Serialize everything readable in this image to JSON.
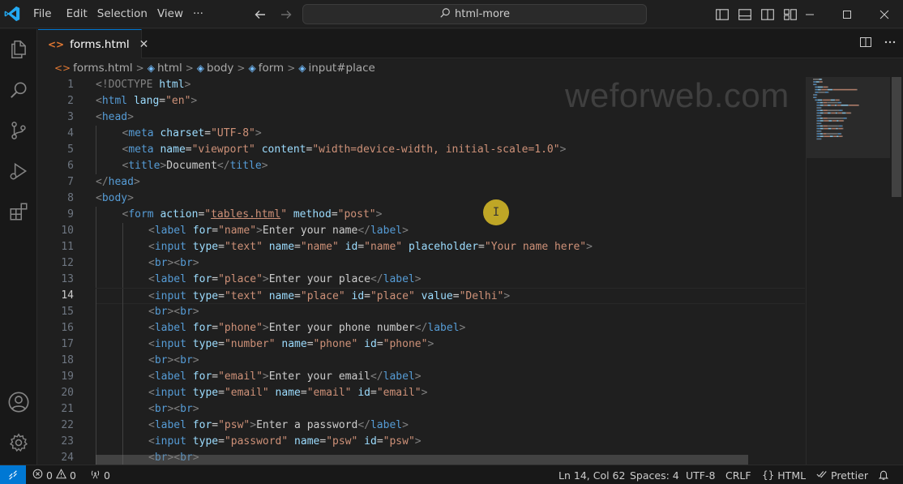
{
  "menu": {
    "file": "File",
    "edit": "Edit",
    "selection": "Selection",
    "view": "View",
    "more": "···"
  },
  "search": {
    "text": "html-more"
  },
  "tab": {
    "label": "forms.html",
    "icon": "html-file-icon",
    "close": "✕"
  },
  "breadcrumb": [
    "forms.html",
    "html",
    "body",
    "form",
    "input#place"
  ],
  "watermark": "weforweb.com",
  "cursor_glyph": "I",
  "editor": {
    "active_line": 14,
    "line_numbers": [
      "1",
      "2",
      "3",
      "4",
      "5",
      "6",
      "7",
      "8",
      "9",
      "10",
      "11",
      "12",
      "13",
      "14",
      "15",
      "16",
      "17",
      "18",
      "19",
      "20",
      "21",
      "22",
      "23",
      "24"
    ],
    "lines": [
      {
        "indent": 0,
        "tokens": [
          {
            "t": "<!DOCTYPE ",
            "c": "t-dt"
          },
          {
            "t": "html",
            "c": "t-attr"
          },
          {
            "t": ">",
            "c": "t-dt"
          }
        ]
      },
      {
        "indent": 0,
        "tokens": [
          {
            "t": "<",
            "c": "t-dt"
          },
          {
            "t": "html",
            "c": "t-tag"
          },
          {
            "t": " lang",
            "c": "t-attr"
          },
          {
            "t": "=",
            "c": "t-txt"
          },
          {
            "t": "\"en\"",
            "c": "t-str"
          },
          {
            "t": ">",
            "c": "t-dt"
          }
        ]
      },
      {
        "indent": 0,
        "tokens": [
          {
            "t": "<",
            "c": "t-dt"
          },
          {
            "t": "head",
            "c": "t-tag"
          },
          {
            "t": ">",
            "c": "t-dt"
          }
        ]
      },
      {
        "indent": 1,
        "tokens": [
          {
            "t": "<",
            "c": "t-dt"
          },
          {
            "t": "meta",
            "c": "t-tag"
          },
          {
            "t": " charset",
            "c": "t-attr"
          },
          {
            "t": "=",
            "c": "t-txt"
          },
          {
            "t": "\"UTF-8\"",
            "c": "t-str"
          },
          {
            "t": ">",
            "c": "t-dt"
          }
        ]
      },
      {
        "indent": 1,
        "tokens": [
          {
            "t": "<",
            "c": "t-dt"
          },
          {
            "t": "meta",
            "c": "t-tag"
          },
          {
            "t": " name",
            "c": "t-attr"
          },
          {
            "t": "=",
            "c": "t-txt"
          },
          {
            "t": "\"viewport\"",
            "c": "t-str"
          },
          {
            "t": " content",
            "c": "t-attr"
          },
          {
            "t": "=",
            "c": "t-txt"
          },
          {
            "t": "\"width=device-width, initial-scale=1.0\"",
            "c": "t-str"
          },
          {
            "t": ">",
            "c": "t-dt"
          }
        ]
      },
      {
        "indent": 1,
        "tokens": [
          {
            "t": "<",
            "c": "t-dt"
          },
          {
            "t": "title",
            "c": "t-tag"
          },
          {
            "t": ">",
            "c": "t-dt"
          },
          {
            "t": "Document",
            "c": "t-txt"
          },
          {
            "t": "</",
            "c": "t-dt"
          },
          {
            "t": "title",
            "c": "t-tag"
          },
          {
            "t": ">",
            "c": "t-dt"
          }
        ]
      },
      {
        "indent": 0,
        "tokens": [
          {
            "t": "</",
            "c": "t-dt"
          },
          {
            "t": "head",
            "c": "t-tag"
          },
          {
            "t": ">",
            "c": "t-dt"
          }
        ]
      },
      {
        "indent": 0,
        "tokens": [
          {
            "t": "<",
            "c": "t-dt"
          },
          {
            "t": "body",
            "c": "t-tag"
          },
          {
            "t": ">",
            "c": "t-dt"
          }
        ]
      },
      {
        "indent": 1,
        "tokens": [
          {
            "t": "<",
            "c": "t-dt"
          },
          {
            "t": "form",
            "c": "t-tag"
          },
          {
            "t": " action",
            "c": "t-attr"
          },
          {
            "t": "=",
            "c": "t-txt"
          },
          {
            "t": "\"",
            "c": "t-str"
          },
          {
            "t": "tables.html",
            "c": "t-str t-link"
          },
          {
            "t": "\"",
            "c": "t-str"
          },
          {
            "t": " method",
            "c": "t-attr"
          },
          {
            "t": "=",
            "c": "t-txt"
          },
          {
            "t": "\"post\"",
            "c": "t-str"
          },
          {
            "t": ">",
            "c": "t-dt"
          }
        ]
      },
      {
        "indent": 2,
        "tokens": [
          {
            "t": "<",
            "c": "t-dt"
          },
          {
            "t": "label",
            "c": "t-tag"
          },
          {
            "t": " for",
            "c": "t-attr"
          },
          {
            "t": "=",
            "c": "t-txt"
          },
          {
            "t": "\"name\"",
            "c": "t-str"
          },
          {
            "t": ">",
            "c": "t-dt"
          },
          {
            "t": "Enter your name",
            "c": "t-txt"
          },
          {
            "t": "</",
            "c": "t-dt"
          },
          {
            "t": "label",
            "c": "t-tag"
          },
          {
            "t": ">",
            "c": "t-dt"
          }
        ]
      },
      {
        "indent": 2,
        "tokens": [
          {
            "t": "<",
            "c": "t-dt"
          },
          {
            "t": "input",
            "c": "t-tag"
          },
          {
            "t": " type",
            "c": "t-attr"
          },
          {
            "t": "=",
            "c": "t-txt"
          },
          {
            "t": "\"text\"",
            "c": "t-str"
          },
          {
            "t": " name",
            "c": "t-attr"
          },
          {
            "t": "=",
            "c": "t-txt"
          },
          {
            "t": "\"name\"",
            "c": "t-str"
          },
          {
            "t": " id",
            "c": "t-attr"
          },
          {
            "t": "=",
            "c": "t-txt"
          },
          {
            "t": "\"name\"",
            "c": "t-str"
          },
          {
            "t": " placeholder",
            "c": "t-attr"
          },
          {
            "t": "=",
            "c": "t-txt"
          },
          {
            "t": "\"Your name here\"",
            "c": "t-str"
          },
          {
            "t": ">",
            "c": "t-dt"
          }
        ]
      },
      {
        "indent": 2,
        "tokens": [
          {
            "t": "<",
            "c": "t-dt"
          },
          {
            "t": "br",
            "c": "t-tag"
          },
          {
            "t": "><",
            "c": "t-dt"
          },
          {
            "t": "br",
            "c": "t-tag"
          },
          {
            "t": ">",
            "c": "t-dt"
          }
        ]
      },
      {
        "indent": 2,
        "tokens": [
          {
            "t": "<",
            "c": "t-dt"
          },
          {
            "t": "label",
            "c": "t-tag"
          },
          {
            "t": " for",
            "c": "t-attr"
          },
          {
            "t": "=",
            "c": "t-txt"
          },
          {
            "t": "\"place\"",
            "c": "t-str"
          },
          {
            "t": ">",
            "c": "t-dt"
          },
          {
            "t": "Enter your place",
            "c": "t-txt"
          },
          {
            "t": "</",
            "c": "t-dt"
          },
          {
            "t": "label",
            "c": "t-tag"
          },
          {
            "t": ">",
            "c": "t-dt"
          }
        ]
      },
      {
        "indent": 2,
        "tokens": [
          {
            "t": "<",
            "c": "t-dt"
          },
          {
            "t": "input",
            "c": "t-tag"
          },
          {
            "t": " type",
            "c": "t-attr"
          },
          {
            "t": "=",
            "c": "t-txt"
          },
          {
            "t": "\"text\"",
            "c": "t-str"
          },
          {
            "t": " name",
            "c": "t-attr"
          },
          {
            "t": "=",
            "c": "t-txt"
          },
          {
            "t": "\"place\"",
            "c": "t-str"
          },
          {
            "t": " id",
            "c": "t-attr"
          },
          {
            "t": "=",
            "c": "t-txt"
          },
          {
            "t": "\"place\"",
            "c": "t-str"
          },
          {
            "t": " value",
            "c": "t-attr"
          },
          {
            "t": "=",
            "c": "t-txt"
          },
          {
            "t": "\"Delhi\"",
            "c": "t-str"
          },
          {
            "t": ">",
            "c": "t-dt"
          }
        ]
      },
      {
        "indent": 2,
        "tokens": [
          {
            "t": "<",
            "c": "t-dt"
          },
          {
            "t": "br",
            "c": "t-tag"
          },
          {
            "t": "><",
            "c": "t-dt"
          },
          {
            "t": "br",
            "c": "t-tag"
          },
          {
            "t": ">",
            "c": "t-dt"
          }
        ]
      },
      {
        "indent": 2,
        "tokens": [
          {
            "t": "<",
            "c": "t-dt"
          },
          {
            "t": "label",
            "c": "t-tag"
          },
          {
            "t": " for",
            "c": "t-attr"
          },
          {
            "t": "=",
            "c": "t-txt"
          },
          {
            "t": "\"phone\"",
            "c": "t-str"
          },
          {
            "t": ">",
            "c": "t-dt"
          },
          {
            "t": "Enter your phone number",
            "c": "t-txt"
          },
          {
            "t": "</",
            "c": "t-dt"
          },
          {
            "t": "label",
            "c": "t-tag"
          },
          {
            "t": ">",
            "c": "t-dt"
          }
        ]
      },
      {
        "indent": 2,
        "tokens": [
          {
            "t": "<",
            "c": "t-dt"
          },
          {
            "t": "input",
            "c": "t-tag"
          },
          {
            "t": " type",
            "c": "t-attr"
          },
          {
            "t": "=",
            "c": "t-txt"
          },
          {
            "t": "\"number\"",
            "c": "t-str"
          },
          {
            "t": " name",
            "c": "t-attr"
          },
          {
            "t": "=",
            "c": "t-txt"
          },
          {
            "t": "\"phone\"",
            "c": "t-str"
          },
          {
            "t": " id",
            "c": "t-attr"
          },
          {
            "t": "=",
            "c": "t-txt"
          },
          {
            "t": "\"phone\"",
            "c": "t-str"
          },
          {
            "t": ">",
            "c": "t-dt"
          }
        ]
      },
      {
        "indent": 2,
        "tokens": [
          {
            "t": "<",
            "c": "t-dt"
          },
          {
            "t": "br",
            "c": "t-tag"
          },
          {
            "t": "><",
            "c": "t-dt"
          },
          {
            "t": "br",
            "c": "t-tag"
          },
          {
            "t": ">",
            "c": "t-dt"
          }
        ]
      },
      {
        "indent": 2,
        "tokens": [
          {
            "t": "<",
            "c": "t-dt"
          },
          {
            "t": "label",
            "c": "t-tag"
          },
          {
            "t": " for",
            "c": "t-attr"
          },
          {
            "t": "=",
            "c": "t-txt"
          },
          {
            "t": "\"email\"",
            "c": "t-str"
          },
          {
            "t": ">",
            "c": "t-dt"
          },
          {
            "t": "Enter your email",
            "c": "t-txt"
          },
          {
            "t": "</",
            "c": "t-dt"
          },
          {
            "t": "label",
            "c": "t-tag"
          },
          {
            "t": ">",
            "c": "t-dt"
          }
        ]
      },
      {
        "indent": 2,
        "tokens": [
          {
            "t": "<",
            "c": "t-dt"
          },
          {
            "t": "input",
            "c": "t-tag"
          },
          {
            "t": " type",
            "c": "t-attr"
          },
          {
            "t": "=",
            "c": "t-txt"
          },
          {
            "t": "\"email\"",
            "c": "t-str"
          },
          {
            "t": " name",
            "c": "t-attr"
          },
          {
            "t": "=",
            "c": "t-txt"
          },
          {
            "t": "\"email\"",
            "c": "t-str"
          },
          {
            "t": " id",
            "c": "t-attr"
          },
          {
            "t": "=",
            "c": "t-txt"
          },
          {
            "t": "\"email\"",
            "c": "t-str"
          },
          {
            "t": ">",
            "c": "t-dt"
          }
        ]
      },
      {
        "indent": 2,
        "tokens": [
          {
            "t": "<",
            "c": "t-dt"
          },
          {
            "t": "br",
            "c": "t-tag"
          },
          {
            "t": "><",
            "c": "t-dt"
          },
          {
            "t": "br",
            "c": "t-tag"
          },
          {
            "t": ">",
            "c": "t-dt"
          }
        ]
      },
      {
        "indent": 2,
        "tokens": [
          {
            "t": "<",
            "c": "t-dt"
          },
          {
            "t": "label",
            "c": "t-tag"
          },
          {
            "t": " for",
            "c": "t-attr"
          },
          {
            "t": "=",
            "c": "t-txt"
          },
          {
            "t": "\"psw\"",
            "c": "t-str"
          },
          {
            "t": ">",
            "c": "t-dt"
          },
          {
            "t": "Enter a password",
            "c": "t-txt"
          },
          {
            "t": "</",
            "c": "t-dt"
          },
          {
            "t": "label",
            "c": "t-tag"
          },
          {
            "t": ">",
            "c": "t-dt"
          }
        ]
      },
      {
        "indent": 2,
        "tokens": [
          {
            "t": "<",
            "c": "t-dt"
          },
          {
            "t": "input",
            "c": "t-tag"
          },
          {
            "t": " type",
            "c": "t-attr"
          },
          {
            "t": "=",
            "c": "t-txt"
          },
          {
            "t": "\"password\"",
            "c": "t-str"
          },
          {
            "t": " name",
            "c": "t-attr"
          },
          {
            "t": "=",
            "c": "t-txt"
          },
          {
            "t": "\"psw\"",
            "c": "t-str"
          },
          {
            "t": " id",
            "c": "t-attr"
          },
          {
            "t": "=",
            "c": "t-txt"
          },
          {
            "t": "\"psw\"",
            "c": "t-str"
          },
          {
            "t": ">",
            "c": "t-dt"
          }
        ]
      },
      {
        "indent": 2,
        "tokens": [
          {
            "t": "<",
            "c": "t-dt"
          },
          {
            "t": "br",
            "c": "t-tag"
          },
          {
            "t": "><",
            "c": "t-dt"
          },
          {
            "t": "br",
            "c": "t-tag"
          },
          {
            "t": ">",
            "c": "t-dt"
          }
        ]
      }
    ]
  },
  "status": {
    "errors": "0",
    "warnings": "0",
    "ports": "0",
    "position": "Ln 14, Col 62",
    "spaces": "Spaces: 4",
    "encoding": "UTF-8",
    "eol": "CRLF",
    "language": "HTML",
    "formatter": "Prettier"
  },
  "colors": {
    "accent": "#0078d4",
    "tag": "#569cd6",
    "attr": "#9cdcfe",
    "string": "#ce9178"
  }
}
